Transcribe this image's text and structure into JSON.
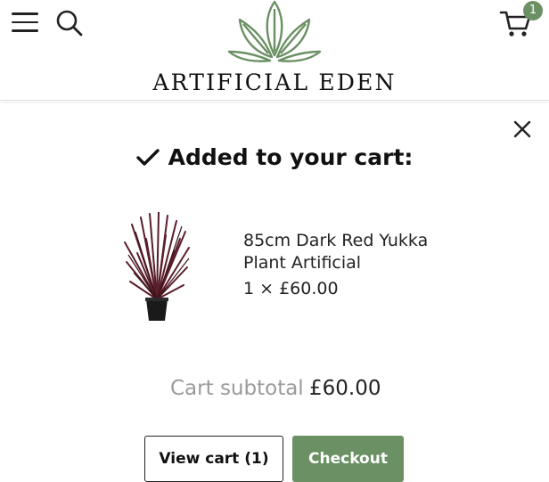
{
  "header": {
    "brand_name": "ARTIFICIAL EDEN",
    "cart_count": "1",
    "icons": {
      "menu": "hamburger-menu-icon",
      "search": "magnifier-icon",
      "cart": "shopping-cart-icon",
      "logo": "leaf-emblem-icon"
    },
    "colors": {
      "accent": "#6a9063",
      "text": "#111111"
    }
  },
  "cart_drawer": {
    "title": "Added to your cart:",
    "close_icon": "close-icon",
    "product": {
      "image": "dark-red-yukka-plant-image",
      "name": "85cm Dark Red Yukka Plant Artificial",
      "quantity_price": "1 × £60.00"
    },
    "subtotal_label": "Cart subtotal",
    "subtotal_value": "£60.00",
    "view_cart_label": "View cart (1)",
    "checkout_label": "Checkout"
  }
}
